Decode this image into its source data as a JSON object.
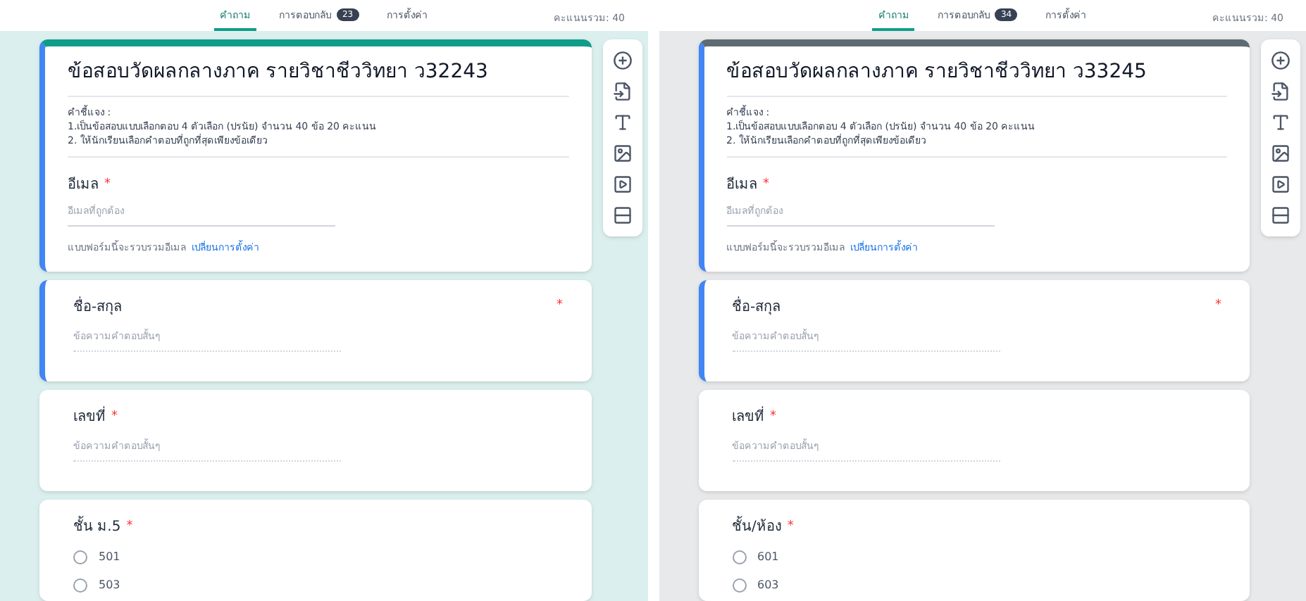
{
  "panels": [
    {
      "color": "#0f9d8a",
      "required_mark": "*",
      "tabs": [
        {
          "label": "คำถาม",
          "selected": true
        },
        {
          "label": "การตอบกลับ",
          "selected": false,
          "badge": "23"
        },
        {
          "label": "การตั้งค่า",
          "selected": false
        }
      ],
      "score": "คะแนนรวม: 40",
      "title": "ข้อสอบวัดผลกลางภาค รายวิชาชีววิทยา ว32243",
      "description": [
        "คำชี้แจง :",
        "1.เป็นข้อสอบแบบเลือกตอบ 4 ตัวเลือก (ปรนัย) จำนวน 40 ข้อ 20 คะแนน",
        "2. ให้นักเรียนเลือกคำตอบที่ถูกที่สุดเพียงข้อเดียว"
      ],
      "email": {
        "label": "อีเมล",
        "placeholder": "อีเมลที่ถูกต้อง",
        "note": "แบบฟอร์มนี้จะรวบรวมอีเมล",
        "link": "เปลี่ยนการตั้งค่า"
      },
      "questions": [
        {
          "kind": "text",
          "label": "ชื่อ-สกุล",
          "selected": true,
          "placeholder": "ข้อความคำตอบสั้นๆ"
        },
        {
          "kind": "text",
          "label": "เลขที่",
          "selected": false,
          "placeholder": "ข้อความคำตอบสั้นๆ"
        },
        {
          "kind": "choice",
          "label": "ชั้น ม.5",
          "selected": false,
          "options": [
            "501",
            "503"
          ]
        }
      ]
    },
    {
      "color": "#5f6b73",
      "required_mark": "*",
      "tabs": [
        {
          "label": "คำถาม",
          "selected": true
        },
        {
          "label": "การตอบกลับ",
          "selected": false,
          "badge": "34"
        },
        {
          "label": "การตั้งค่า",
          "selected": false
        }
      ],
      "score": "คะแนนรวม: 40",
      "title": "ข้อสอบวัดผลกลางภาค รายวิชาชีววิทยา ว33245",
      "description": [
        "คำชี้แจง :",
        "1.เป็นข้อสอบแบบเลือกตอบ 4 ตัวเลือก (ปรนัย) จำนวน 40 ข้อ 20 คะแนน",
        "2. ให้นักเรียนเลือกคำตอบที่ถูกที่สุดเพียงข้อเดียว"
      ],
      "email": {
        "label": "อีเมล",
        "placeholder": "อีเมลที่ถูกต้อง",
        "note": "แบบฟอร์มนี้จะรวบรวมอีเมล",
        "link": "เปลี่ยนการตั้งค่า"
      },
      "questions": [
        {
          "kind": "text",
          "label": "ชื่อ-สกุล",
          "selected": true,
          "placeholder": "ข้อความคำตอบสั้นๆ"
        },
        {
          "kind": "text",
          "label": "เลขที่",
          "selected": false,
          "placeholder": "ข้อความคำตอบสั้นๆ"
        },
        {
          "kind": "choice",
          "label": "ชั้น/ห้อง",
          "selected": false,
          "options": [
            "601",
            "603"
          ]
        }
      ]
    }
  ]
}
